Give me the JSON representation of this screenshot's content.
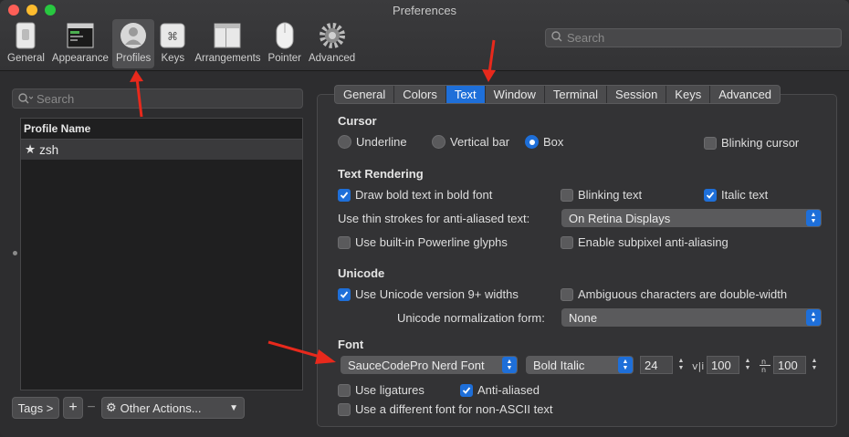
{
  "window": {
    "title": "Preferences"
  },
  "toolbar": {
    "items": [
      {
        "label": "General",
        "icon": "switch-icon"
      },
      {
        "label": "Appearance",
        "icon": "window-icon"
      },
      {
        "label": "Profiles",
        "icon": "person-icon"
      },
      {
        "label": "Keys",
        "icon": "command-key-icon"
      },
      {
        "label": "Arrangements",
        "icon": "windows-stack-icon"
      },
      {
        "label": "Pointer",
        "icon": "mouse-icon"
      },
      {
        "label": "Advanced",
        "icon": "gear-icon"
      }
    ],
    "active": "Profiles",
    "search_placeholder": "Search"
  },
  "sidebar": {
    "search_placeholder": "Search",
    "column_header": "Profile Name",
    "profiles": [
      {
        "name": "zsh",
        "default": true
      }
    ],
    "buttons": {
      "tags": "Tags >",
      "add": "+",
      "remove": "−",
      "other_actions": "Other Actions..."
    }
  },
  "tabs": {
    "items": [
      "General",
      "Colors",
      "Text",
      "Window",
      "Terminal",
      "Session",
      "Keys",
      "Advanced"
    ],
    "active": "Text"
  },
  "cursor": {
    "title": "Cursor",
    "options": [
      "Underline",
      "Vertical bar",
      "Box"
    ],
    "selected": "Box",
    "blinking_label": "Blinking cursor",
    "blinking": false
  },
  "text_rendering": {
    "title": "Text Rendering",
    "bold_label": "Draw bold text in bold font",
    "bold": true,
    "blinking_text_label": "Blinking text",
    "blinking_text": false,
    "italic_label": "Italic text",
    "italic": true,
    "thin_strokes_label": "Use thin strokes for anti-aliased text:",
    "thin_strokes_value": "On Retina Displays",
    "powerline_label": "Use built-in Powerline glyphs",
    "powerline": false,
    "subpixel_label": "Enable subpixel anti-aliasing",
    "subpixel": false
  },
  "unicode": {
    "title": "Unicode",
    "v9_label": "Use Unicode version 9+ widths",
    "v9": true,
    "ambiguous_label": "Ambiguous characters are double-width",
    "ambiguous": false,
    "normalization_label": "Unicode normalization form:",
    "normalization_value": "None"
  },
  "font": {
    "title": "Font",
    "family": "SauceCodePro Nerd Font",
    "style": "Bold Italic",
    "size": "24",
    "h_spacing_icon": "v|i",
    "h_spacing": "100",
    "v_spacing_icon": "n over n",
    "v_spacing": "100",
    "ligatures_label": "Use ligatures",
    "ligatures": false,
    "antialiased_label": "Anti-aliased",
    "antialiased": true,
    "non_ascii_label": "Use a different font for non-ASCII text",
    "non_ascii": false
  },
  "colors": {
    "accent": "#1e6fd9",
    "annotation_arrow": "#e8291c",
    "traffic_close": "#fe5f57",
    "traffic_min": "#febc2e",
    "traffic_max": "#28c840"
  }
}
